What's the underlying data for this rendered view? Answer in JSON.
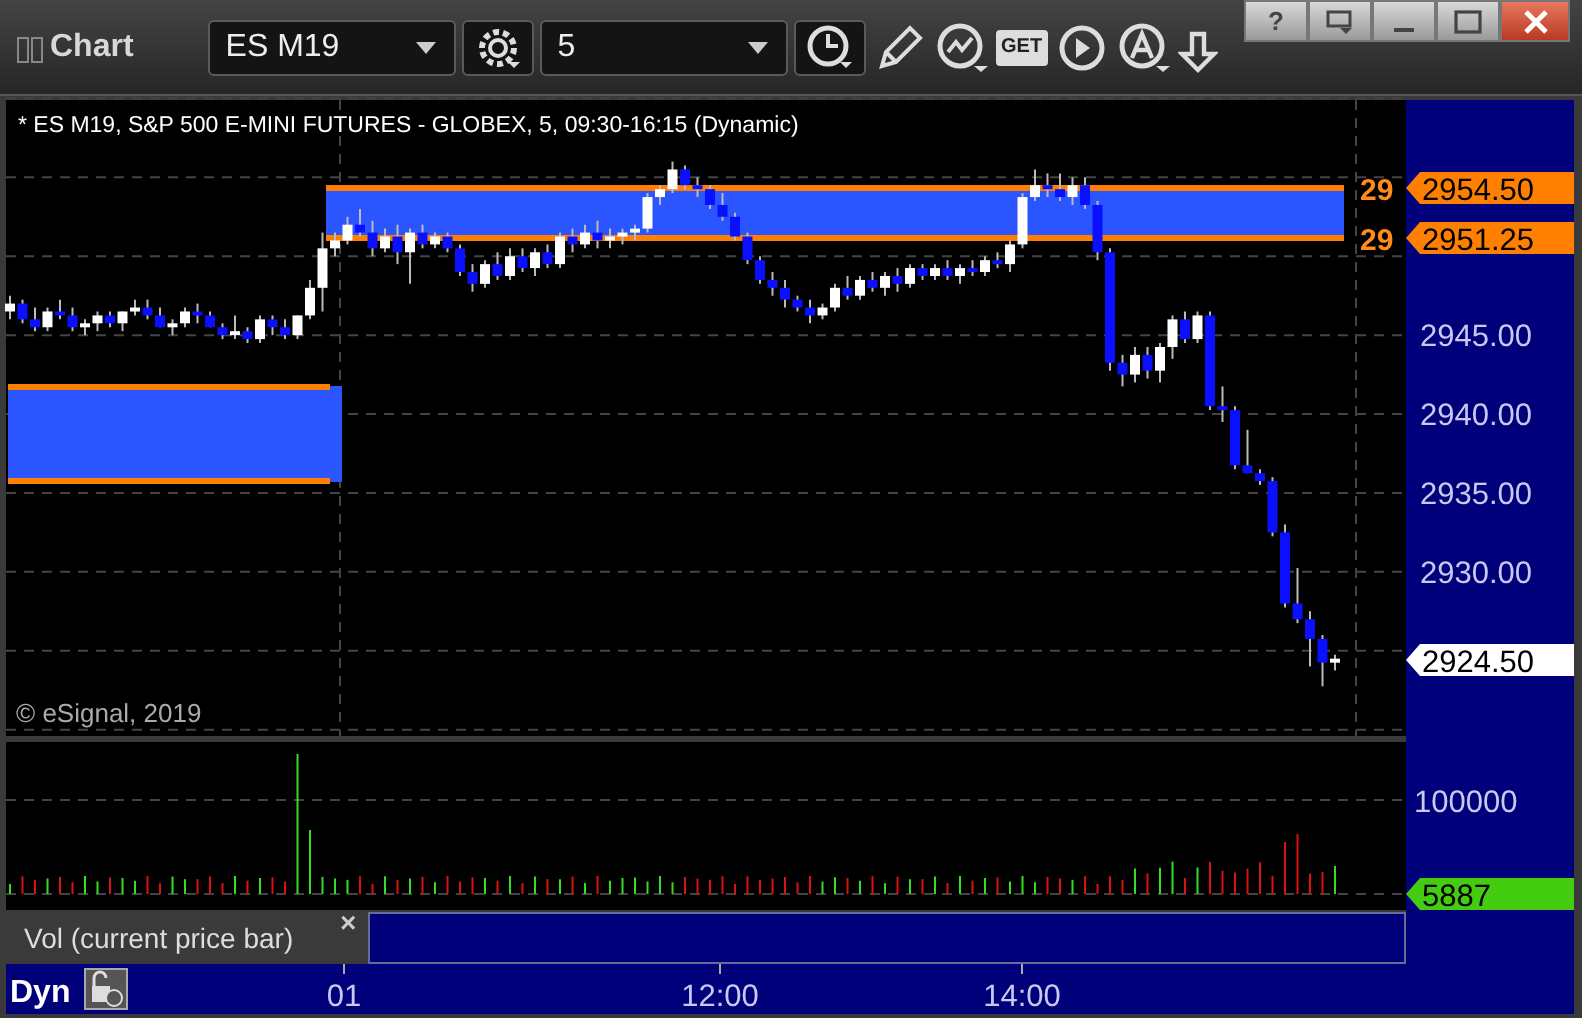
{
  "window": {
    "title": "Chart",
    "help": "?"
  },
  "toolbar": {
    "symbol": "ES M19",
    "interval": "5",
    "get": "GET"
  },
  "price_pane": {
    "header": "* ES M19, S&P 500 E-MINI FUTURES - GLOBEX, 5, 09:30-16:15 (Dynamic)",
    "copyright": "© eSignal, 2019",
    "chart_data": {
      "type": "candlestick",
      "categories": [
        null,
        null,
        null,
        null,
        null,
        null,
        null,
        null,
        null,
        null,
        null,
        null,
        null,
        null,
        null,
        null,
        null,
        null,
        null,
        null,
        null,
        null,
        null,
        null,
        null,
        null,
        null,
        null,
        null,
        null,
        null,
        null,
        null,
        null,
        null,
        null,
        null,
        null,
        null,
        null,
        null,
        null,
        null,
        null,
        null,
        null,
        null,
        null,
        null,
        null,
        null,
        null,
        null,
        null,
        null,
        null,
        null,
        null,
        null,
        null,
        null,
        null,
        null,
        null,
        null,
        null,
        null,
        null,
        null,
        null,
        null,
        null,
        null,
        null,
        null,
        null,
        null,
        null,
        null,
        null,
        null,
        null,
        null,
        null,
        null,
        null,
        null,
        null,
        null,
        null,
        null,
        null,
        null,
        null,
        null,
        null,
        null,
        null,
        null,
        null,
        null,
        null,
        null,
        null,
        null,
        null,
        null
      ],
      "ohlc": [
        [
          2946.5,
          2947.5,
          2946,
          2947
        ],
        [
          2947,
          2947.25,
          2945.75,
          2946
        ],
        [
          2946,
          2946.75,
          2945.25,
          2945.5
        ],
        [
          2945.5,
          2946.75,
          2945.25,
          2946.5
        ],
        [
          2946.5,
          2947.25,
          2946,
          2946.25
        ],
        [
          2946.25,
          2946.75,
          2945.25,
          2945.5
        ],
        [
          2945.5,
          2946,
          2945,
          2945.75
        ],
        [
          2945.75,
          2946.5,
          2945.25,
          2946.25
        ],
        [
          2946.25,
          2946.5,
          2945.5,
          2945.75
        ],
        [
          2945.75,
          2946.5,
          2945.25,
          2946.5
        ],
        [
          2946.5,
          2947.25,
          2946.25,
          2946.75
        ],
        [
          2946.75,
          2947.25,
          2946,
          2946.25
        ],
        [
          2946.25,
          2946.75,
          2945.5,
          2945.5
        ],
        [
          2945.5,
          2946,
          2945,
          2945.75
        ],
        [
          2945.75,
          2946.75,
          2945.5,
          2946.5
        ],
        [
          2946.5,
          2947,
          2945.75,
          2946.25
        ],
        [
          2946.25,
          2946.5,
          2945.5,
          2945.5
        ],
        [
          2945.5,
          2945.75,
          2944.75,
          2945
        ],
        [
          2945,
          2946.25,
          2944.75,
          2945.25
        ],
        [
          2945.25,
          2945.5,
          2944.5,
          2944.75
        ],
        [
          2944.75,
          2946.25,
          2944.5,
          2946
        ],
        [
          2946,
          2946.25,
          2945,
          2945.5
        ],
        [
          2945.5,
          2946,
          2944.75,
          2945
        ],
        [
          2945,
          2946.25,
          2944.75,
          2946.25
        ],
        [
          2946.25,
          2948.5,
          2946,
          2948
        ],
        [
          2948,
          2951.5,
          2946.5,
          2950.5
        ],
        [
          2950.5,
          2951.5,
          2950,
          2951
        ],
        [
          2951,
          2952.5,
          2950.75,
          2952
        ],
        [
          2952,
          2953,
          2951.25,
          2951.5
        ],
        [
          2951.5,
          2952.25,
          2950,
          2950.5
        ],
        [
          2950.5,
          2951.75,
          2950.25,
          2951.25
        ],
        [
          2951.25,
          2952,
          2949.5,
          2950.25
        ],
        [
          2950.25,
          2951.75,
          2948.25,
          2951.5
        ],
        [
          2951.5,
          2952,
          2950.5,
          2950.75
        ],
        [
          2950.75,
          2951.5,
          2950.5,
          2951.25
        ],
        [
          2951.25,
          2951.5,
          2950.25,
          2950.5
        ],
        [
          2950.5,
          2950.75,
          2948.75,
          2949
        ],
        [
          2949,
          2949.5,
          2947.75,
          2948.25
        ],
        [
          2948.25,
          2949.75,
          2948,
          2949.5
        ],
        [
          2949.5,
          2950.25,
          2948.5,
          2948.75
        ],
        [
          2948.75,
          2950.5,
          2948.5,
          2950
        ],
        [
          2950,
          2950.5,
          2949,
          2949.25
        ],
        [
          2949.25,
          2950.5,
          2948.75,
          2950.25
        ],
        [
          2950.25,
          2950.75,
          2949.25,
          2949.5
        ],
        [
          2949.5,
          2951.5,
          2949.25,
          2951.25
        ],
        [
          2951.25,
          2951.75,
          2950.25,
          2950.75
        ],
        [
          2950.75,
          2952,
          2950.5,
          2951.5
        ],
        [
          2951.5,
          2952.25,
          2950.5,
          2951
        ],
        [
          2951,
          2951.75,
          2950.5,
          2951.25
        ],
        [
          2951.25,
          2951.75,
          2950.75,
          2951.5
        ],
        [
          2951.5,
          2952,
          2951,
          2951.75
        ],
        [
          2951.75,
          2954,
          2951.5,
          2953.75
        ],
        [
          2953.75,
          2954.5,
          2953.25,
          2954.25
        ],
        [
          2954.25,
          2956,
          2954,
          2955.5
        ],
        [
          2955.5,
          2955.75,
          2954.25,
          2954.5
        ],
        [
          2954.5,
          2955,
          2953.75,
          2954.25
        ],
        [
          2954.25,
          2954.5,
          2953,
          2953.25
        ],
        [
          2953.25,
          2954,
          2952.25,
          2952.5
        ],
        [
          2952.5,
          2952.75,
          2951,
          2951.25
        ],
        [
          2951.25,
          2951.5,
          2949.5,
          2949.75
        ],
        [
          2949.75,
          2950,
          2948.25,
          2948.5
        ],
        [
          2948.5,
          2949,
          2947.5,
          2948
        ],
        [
          2948,
          2948.5,
          2946.75,
          2947.25
        ],
        [
          2947.25,
          2947.5,
          2946.5,
          2946.75
        ],
        [
          2946.75,
          2947.25,
          2945.75,
          2946.25
        ],
        [
          2946.25,
          2947,
          2946,
          2946.75
        ],
        [
          2946.75,
          2948.25,
          2946.5,
          2948
        ],
        [
          2948,
          2948.75,
          2947.25,
          2947.5
        ],
        [
          2947.5,
          2948.75,
          2947.25,
          2948.5
        ],
        [
          2948.5,
          2949,
          2947.75,
          2948
        ],
        [
          2948,
          2949,
          2947.5,
          2948.75
        ],
        [
          2948.75,
          2949.25,
          2947.75,
          2948.25
        ],
        [
          2948.25,
          2949.5,
          2948,
          2949.25
        ],
        [
          2949.25,
          2949.5,
          2948.5,
          2948.75
        ],
        [
          2948.75,
          2949.5,
          2948.5,
          2949.25
        ],
        [
          2949.25,
          2949.75,
          2948.5,
          2948.75
        ],
        [
          2948.75,
          2949.5,
          2948.25,
          2949.25
        ],
        [
          2949.25,
          2949.75,
          2948.75,
          2949
        ],
        [
          2949,
          2950,
          2948.75,
          2949.75
        ],
        [
          2949.75,
          2950.25,
          2949.25,
          2949.5
        ],
        [
          2949.5,
          2951,
          2949,
          2950.75
        ],
        [
          2950.75,
          2954,
          2950.5,
          2953.75
        ],
        [
          2953.75,
          2955.5,
          2953.5,
          2954.5
        ],
        [
          2954.5,
          2955.25,
          2953.75,
          2954.25
        ],
        [
          2954.25,
          2955.25,
          2953.5,
          2953.75
        ],
        [
          2953.75,
          2955,
          2953.25,
          2954.5
        ],
        [
          2954.5,
          2955,
          2953,
          2953.25
        ],
        [
          2953.25,
          2953.5,
          2949.75,
          2950.25
        ],
        [
          2950.25,
          2950.5,
          2942.75,
          2943.25
        ],
        [
          2943.25,
          2943.75,
          2941.75,
          2942.5
        ],
        [
          2942.5,
          2944.25,
          2942,
          2943.75
        ],
        [
          2943.75,
          2944.25,
          2942.25,
          2942.75
        ],
        [
          2942.75,
          2944.5,
          2942,
          2944.25
        ],
        [
          2944.25,
          2946.25,
          2943.5,
          2946
        ],
        [
          2946,
          2946.5,
          2944.5,
          2944.75
        ],
        [
          2944.75,
          2946.5,
          2944.5,
          2946.25
        ],
        [
          2946.25,
          2946.5,
          2940.25,
          2940.5
        ],
        [
          2940.5,
          2941.75,
          2939.5,
          2940.25
        ],
        [
          2940.25,
          2940.5,
          2936.5,
          2936.75
        ],
        [
          2936.75,
          2939,
          2936.25,
          2936.25
        ],
        [
          2936.25,
          2936.5,
          2935.5,
          2935.75
        ],
        [
          2935.75,
          2936,
          2932.25,
          2932.5
        ],
        [
          2932.5,
          2933,
          2927.75,
          2928
        ],
        [
          2928,
          2930.25,
          2926.75,
          2927
        ],
        [
          2927,
          2927.5,
          2924,
          2925.75
        ],
        [
          2925.75,
          2926,
          2922.75,
          2924.25
        ],
        [
          2924.25,
          2924.75,
          2923.75,
          2924.5
        ]
      ],
      "ylim": [
        2919.6,
        2959.9
      ],
      "yticks": [
        {
          "value": 2945,
          "label": "2945.00"
        },
        {
          "value": 2940,
          "label": "2940.00"
        },
        {
          "value": 2935,
          "label": "2935.00"
        },
        {
          "value": 2930,
          "label": "2930.00"
        }
      ]
    },
    "level_labels": [
      "29",
      "29"
    ],
    "markers": [
      {
        "text": "2954.50",
        "kind": "level"
      },
      {
        "text": "2951.25",
        "kind": "level"
      },
      {
        "text": "2924.50",
        "kind": "last"
      }
    ]
  },
  "volume_pane": {
    "y_label": "100000",
    "marker": "5887",
    "legend": "Vol (current price bar)",
    "close": "×"
  },
  "time_axis": {
    "mode": "Dyn",
    "labels": [
      "01",
      "12:00",
      "14:00"
    ]
  }
}
